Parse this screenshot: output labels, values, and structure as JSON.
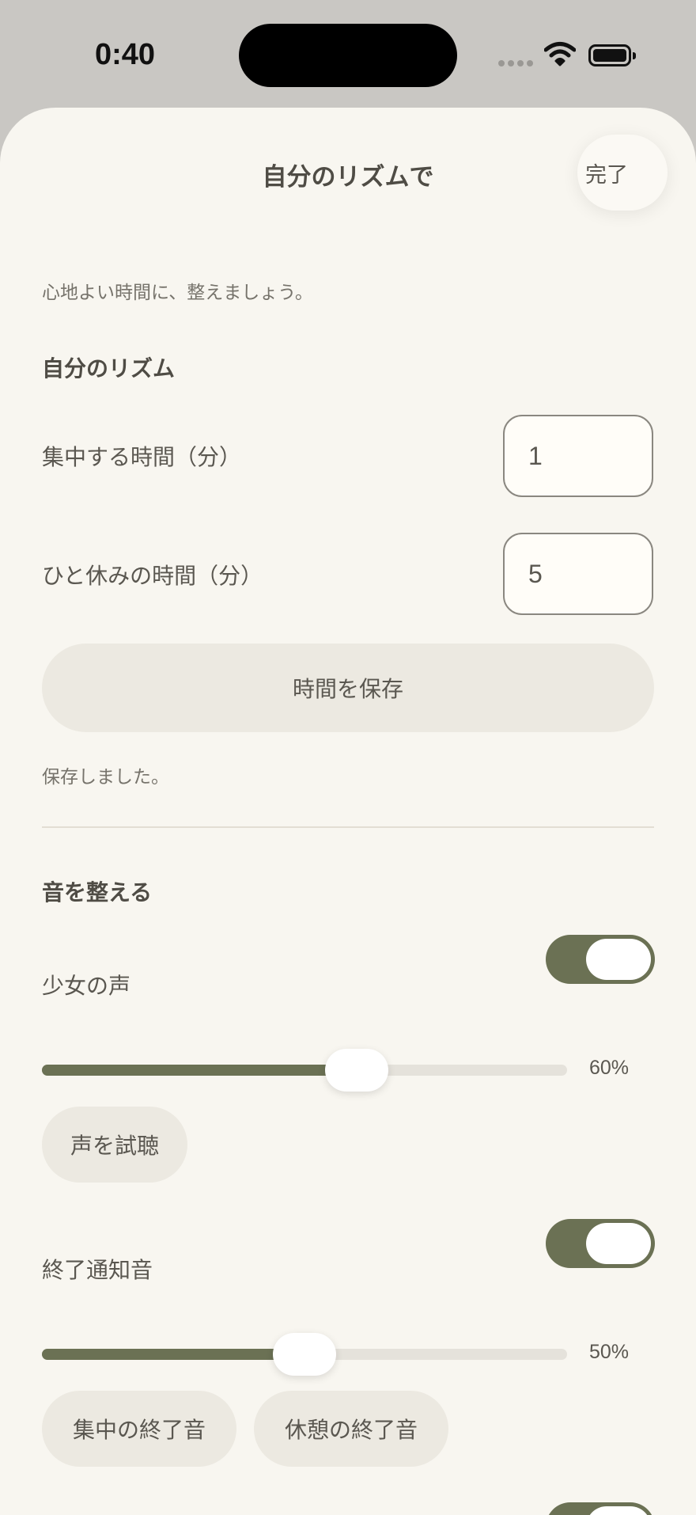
{
  "status_bar": {
    "time": "0:40"
  },
  "sheet": {
    "title": "自分のリズムで",
    "done_label": "完了",
    "subtitle": "心地よい時間に、整えましょう。"
  },
  "rhythm": {
    "heading": "自分のリズム",
    "focus_label": "集中する時間（分）",
    "focus_value": "1",
    "break_label": "ひと休みの時間（分）",
    "break_value": "5",
    "save_label": "時間を保存",
    "saved_message": "保存しました。"
  },
  "sound": {
    "heading": "音を整える",
    "voice": {
      "label": "少女の声",
      "enabled": true,
      "volume": 60,
      "volume_text": "60%",
      "preview_label": "声を試聴"
    },
    "end_chime": {
      "label": "終了通知音",
      "enabled": true,
      "volume": 50,
      "volume_text": "50%",
      "focus_end_label": "集中の終了音",
      "break_end_label": "休憩の終了音"
    }
  },
  "icons": {
    "signal": "signal-dots-icon",
    "wifi": "wifi-icon",
    "battery": "battery-icon"
  },
  "colors": {
    "accent": "#6b7154",
    "sheet_bg": "#f8f6f0",
    "button_bg": "#ece9e1"
  }
}
